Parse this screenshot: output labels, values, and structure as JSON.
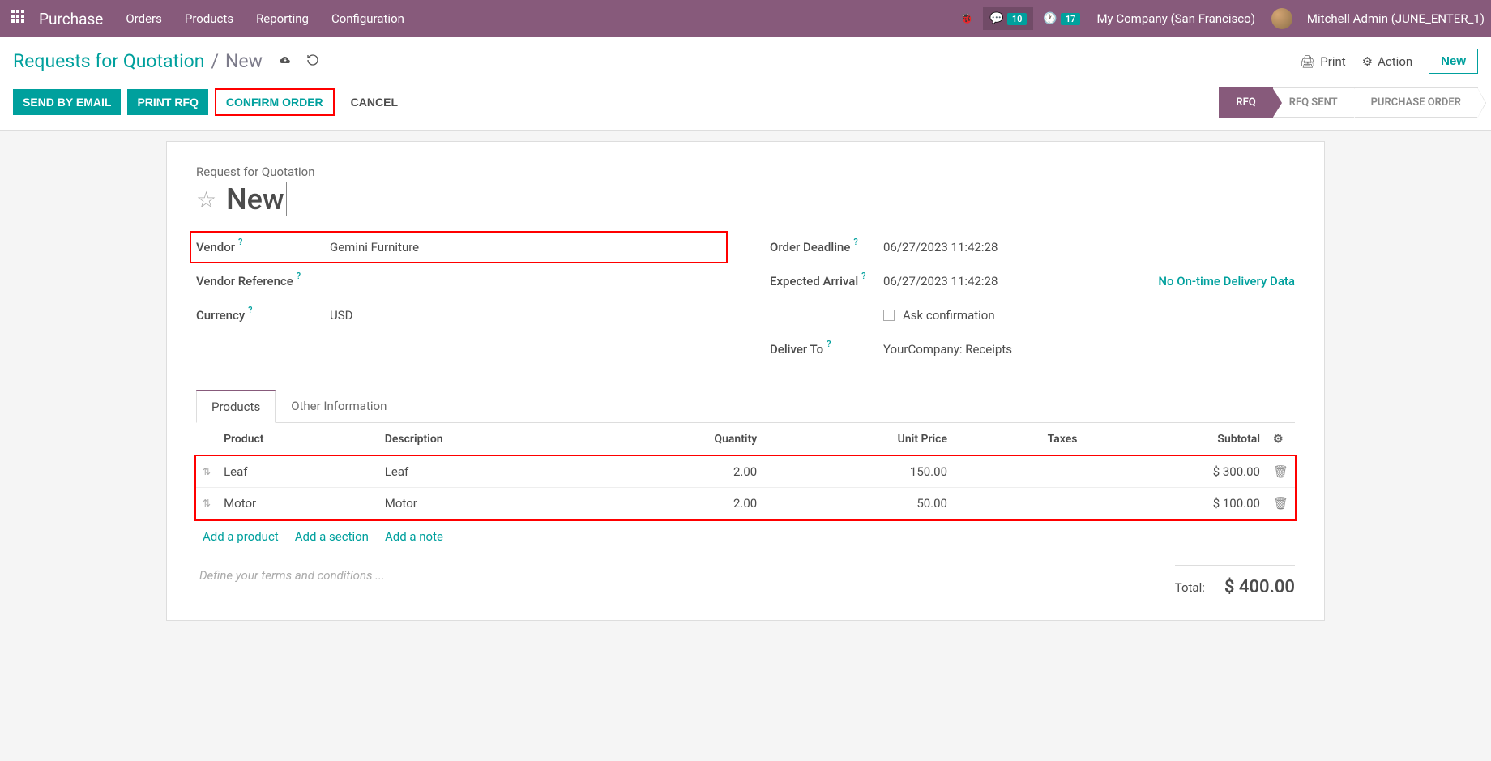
{
  "nav": {
    "app_name": "Purchase",
    "menu": [
      "Orders",
      "Products",
      "Reporting",
      "Configuration"
    ],
    "msg_count": "10",
    "clock_count": "17",
    "company": "My Company (San Francisco)",
    "user": "Mitchell Admin (JUNE_ENTER_1)"
  },
  "breadcrumb": {
    "root": "Requests for Quotation",
    "current": "New"
  },
  "header_actions": {
    "print": "Print",
    "action": "Action",
    "new": "New"
  },
  "buttons": {
    "send_email": "SEND BY EMAIL",
    "print_rfq": "PRINT RFQ",
    "confirm_order": "CONFIRM ORDER",
    "cancel": "CANCEL"
  },
  "status": [
    "RFQ",
    "RFQ SENT",
    "PURCHASE ORDER"
  ],
  "form": {
    "subtitle": "Request for Quotation",
    "name": "New",
    "left": {
      "vendor_label": "Vendor",
      "vendor": "Gemini Furniture",
      "vendor_ref_label": "Vendor Reference",
      "vendor_ref": "",
      "currency_label": "Currency",
      "currency": "USD"
    },
    "right": {
      "deadline_label": "Order Deadline",
      "deadline": "06/27/2023 11:42:28",
      "arrival_label": "Expected Arrival",
      "arrival": "06/27/2023 11:42:28",
      "delivery_link": "No On-time Delivery Data",
      "ask_conf": "Ask confirmation",
      "deliver_label": "Deliver To",
      "deliver": "YourCompany: Receipts"
    }
  },
  "tabs": [
    "Products",
    "Other Information"
  ],
  "table": {
    "cols": {
      "product": "Product",
      "desc": "Description",
      "qty": "Quantity",
      "price": "Unit Price",
      "taxes": "Taxes",
      "subtotal": "Subtotal"
    },
    "rows": [
      {
        "product": "Leaf",
        "desc": "Leaf",
        "qty": "2.00",
        "price": "150.00",
        "taxes": "",
        "subtotal": "$ 300.00"
      },
      {
        "product": "Motor",
        "desc": "Motor",
        "qty": "2.00",
        "price": "50.00",
        "taxes": "",
        "subtotal": "$ 100.00"
      }
    ],
    "add_product": "Add a product",
    "add_section": "Add a section",
    "add_note": "Add a note"
  },
  "terms_placeholder": "Define your terms and conditions ...",
  "total_label": "Total:",
  "total": "$ 400.00"
}
